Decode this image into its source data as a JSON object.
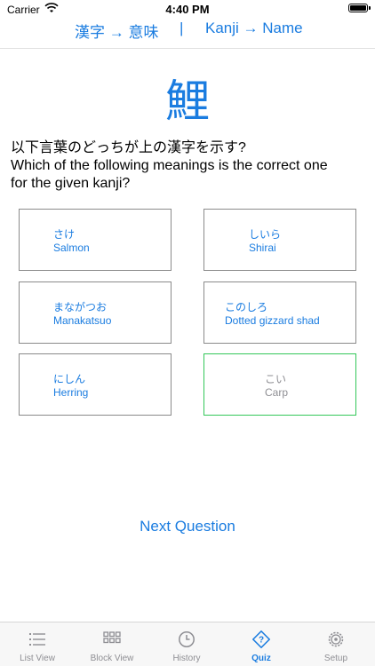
{
  "status_bar": {
    "carrier": "Carrier",
    "time": "4:40 PM"
  },
  "mode_header": {
    "left_label": "漢字 → 意味",
    "separator": "|",
    "right_label": "Kanji → Name"
  },
  "quiz": {
    "kanji": "鯉",
    "question_ja": "以下言葉のどっちが上の漢字を示す?",
    "question_en_line1": "Which of the following meanings is the correct one",
    "question_en_line2": "for the given kanji?",
    "answers": [
      {
        "kana": "さけ",
        "meaning": "Salmon",
        "state": "default"
      },
      {
        "kana": "しいら",
        "meaning": "Shirai",
        "state": "default"
      },
      {
        "kana": "まながつお",
        "meaning": "Manakatsuo",
        "state": "default"
      },
      {
        "kana": "このしろ",
        "meaning": "Dotted gizzard shad",
        "state": "default"
      },
      {
        "kana": "にしん",
        "meaning": "Herring",
        "state": "default"
      },
      {
        "kana": "こい",
        "meaning": "Carp",
        "state": "correct"
      }
    ],
    "next_label": "Next Question"
  },
  "tabs": [
    {
      "label": "List View",
      "icon": "list-icon",
      "active": false
    },
    {
      "label": "Block View",
      "icon": "grid-icon",
      "active": false
    },
    {
      "label": "History",
      "icon": "clock-icon",
      "active": false
    },
    {
      "label": "Quiz",
      "icon": "question-diamond-icon",
      "active": true
    },
    {
      "label": "Setup",
      "icon": "gear-icon",
      "active": false
    }
  ],
  "colors": {
    "accent": "#1a7ce0",
    "correct_border": "#34c759",
    "inactive": "#8e8e93"
  }
}
